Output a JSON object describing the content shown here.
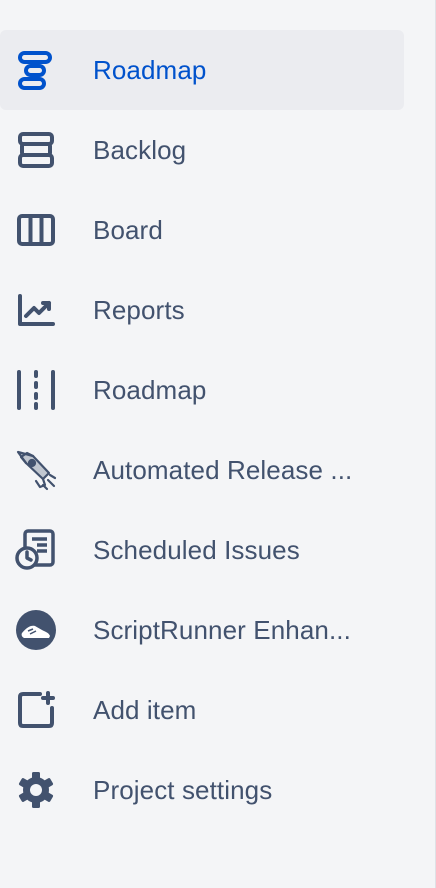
{
  "sidebar": {
    "items": [
      {
        "label": "Roadmap",
        "icon": "roadmap-icon",
        "active": true
      },
      {
        "label": "Backlog",
        "icon": "backlog-icon"
      },
      {
        "label": "Board",
        "icon": "board-icon"
      },
      {
        "label": "Reports",
        "icon": "reports-icon"
      },
      {
        "label": "Roadmap",
        "icon": "roadmap-dashed-icon"
      },
      {
        "label": "Automated Release ...",
        "icon": "rocket-icon"
      },
      {
        "label": "Scheduled Issues",
        "icon": "scheduled-issues-icon"
      },
      {
        "label": "ScriptRunner Enhan...",
        "icon": "scriptrunner-icon"
      },
      {
        "label": "Add item",
        "icon": "add-item-icon"
      },
      {
        "label": "Project settings",
        "icon": "gear-icon"
      }
    ]
  },
  "colors": {
    "background": "#f4f5f7",
    "active_bg": "#ebecf0",
    "active_text": "#0052cc",
    "text": "#42526e"
  }
}
